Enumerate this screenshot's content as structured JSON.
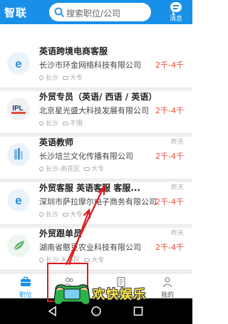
{
  "header": {
    "logo": "智联",
    "search_placeholder": "搜索职位/公司",
    "message_label": "消息"
  },
  "jobs": [
    {
      "title": "英语跨境电商客服",
      "company": "长沙市环金网络科技有限公司",
      "location": "长沙",
      "education": "大专",
      "date": "",
      "salary": "2千-4千",
      "logo_icon": "ie-icon"
    },
    {
      "title": "外贸专员（英语/ 西语 / 英语）",
      "company": "北京星光盛大科技发展有限公司",
      "location": "长沙",
      "education": "不限",
      "date": "",
      "salary": "2千-4千",
      "logo_icon": "ipl-logo-icon"
    },
    {
      "title": "英语教师",
      "company": "长沙培兰文化传播有限公司",
      "location": "长沙-雨花区",
      "education": "大专",
      "date": "昨天",
      "salary": "2千-4千",
      "logo_icon": "building-icon"
    },
    {
      "title": "外贸客服  英语客服  客服...",
      "company": "深圳市萨拉摩尔电子商务有限公司",
      "location": "长沙",
      "education": "大专",
      "date": "昨天",
      "salary": "2千-4千",
      "logo_icon": "ie-icon"
    },
    {
      "title": "外贸跟单员",
      "company": "湖南省憨豆农业科技有限公司",
      "location": "长沙-天心区",
      "education": "大专",
      "date": "昨天",
      "salary": "2千-4千",
      "logo_icon": "leaf-icon"
    }
  ],
  "tabbar": {
    "tabs": [
      {
        "label": "职位",
        "icon": "briefcase-icon",
        "active": true
      },
      {
        "label": "",
        "icon": "people-icon",
        "active": false
      },
      {
        "label": "简历",
        "icon": "document-icon",
        "active": false
      },
      {
        "label": "我的",
        "icon": "person-icon",
        "active": false
      }
    ]
  },
  "watermark": {
    "text": "欢快娱乐"
  },
  "colors": {
    "brand": "#1890e8",
    "salary": "#ef4c3c",
    "annotation": "#e0191f"
  }
}
